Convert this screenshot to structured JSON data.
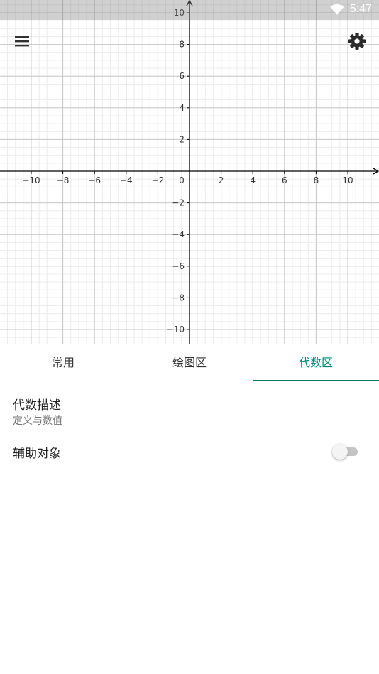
{
  "status_bar": {
    "time": "5:47",
    "icons": [
      "wifi-icon"
    ]
  },
  "toolbar": {
    "menu_icon": "menu-icon",
    "settings_icon": "gear-icon"
  },
  "graph": {
    "x_ticks": [
      "−10",
      "−8",
      "−6",
      "−4",
      "−2",
      "0",
      "2",
      "4",
      "6",
      "8",
      "10"
    ],
    "y_ticks": [
      "10",
      "8",
      "6",
      "4",
      "2",
      "−2",
      "−4",
      "−6",
      "−8",
      "−10"
    ]
  },
  "tabs": [
    {
      "label": "常用",
      "active": false
    },
    {
      "label": "绘图区",
      "active": false
    },
    {
      "label": "代数区",
      "active": true
    }
  ],
  "settings": {
    "algebra_desc_title": "代数描述",
    "algebra_desc_value": "定义与数值",
    "aux_objects_label": "辅助对象",
    "aux_objects_enabled": false
  },
  "colors": {
    "accent": "#00897b",
    "axis": "#000000",
    "grid_major": "#c8c8c8",
    "grid_minor": "#ececec"
  }
}
